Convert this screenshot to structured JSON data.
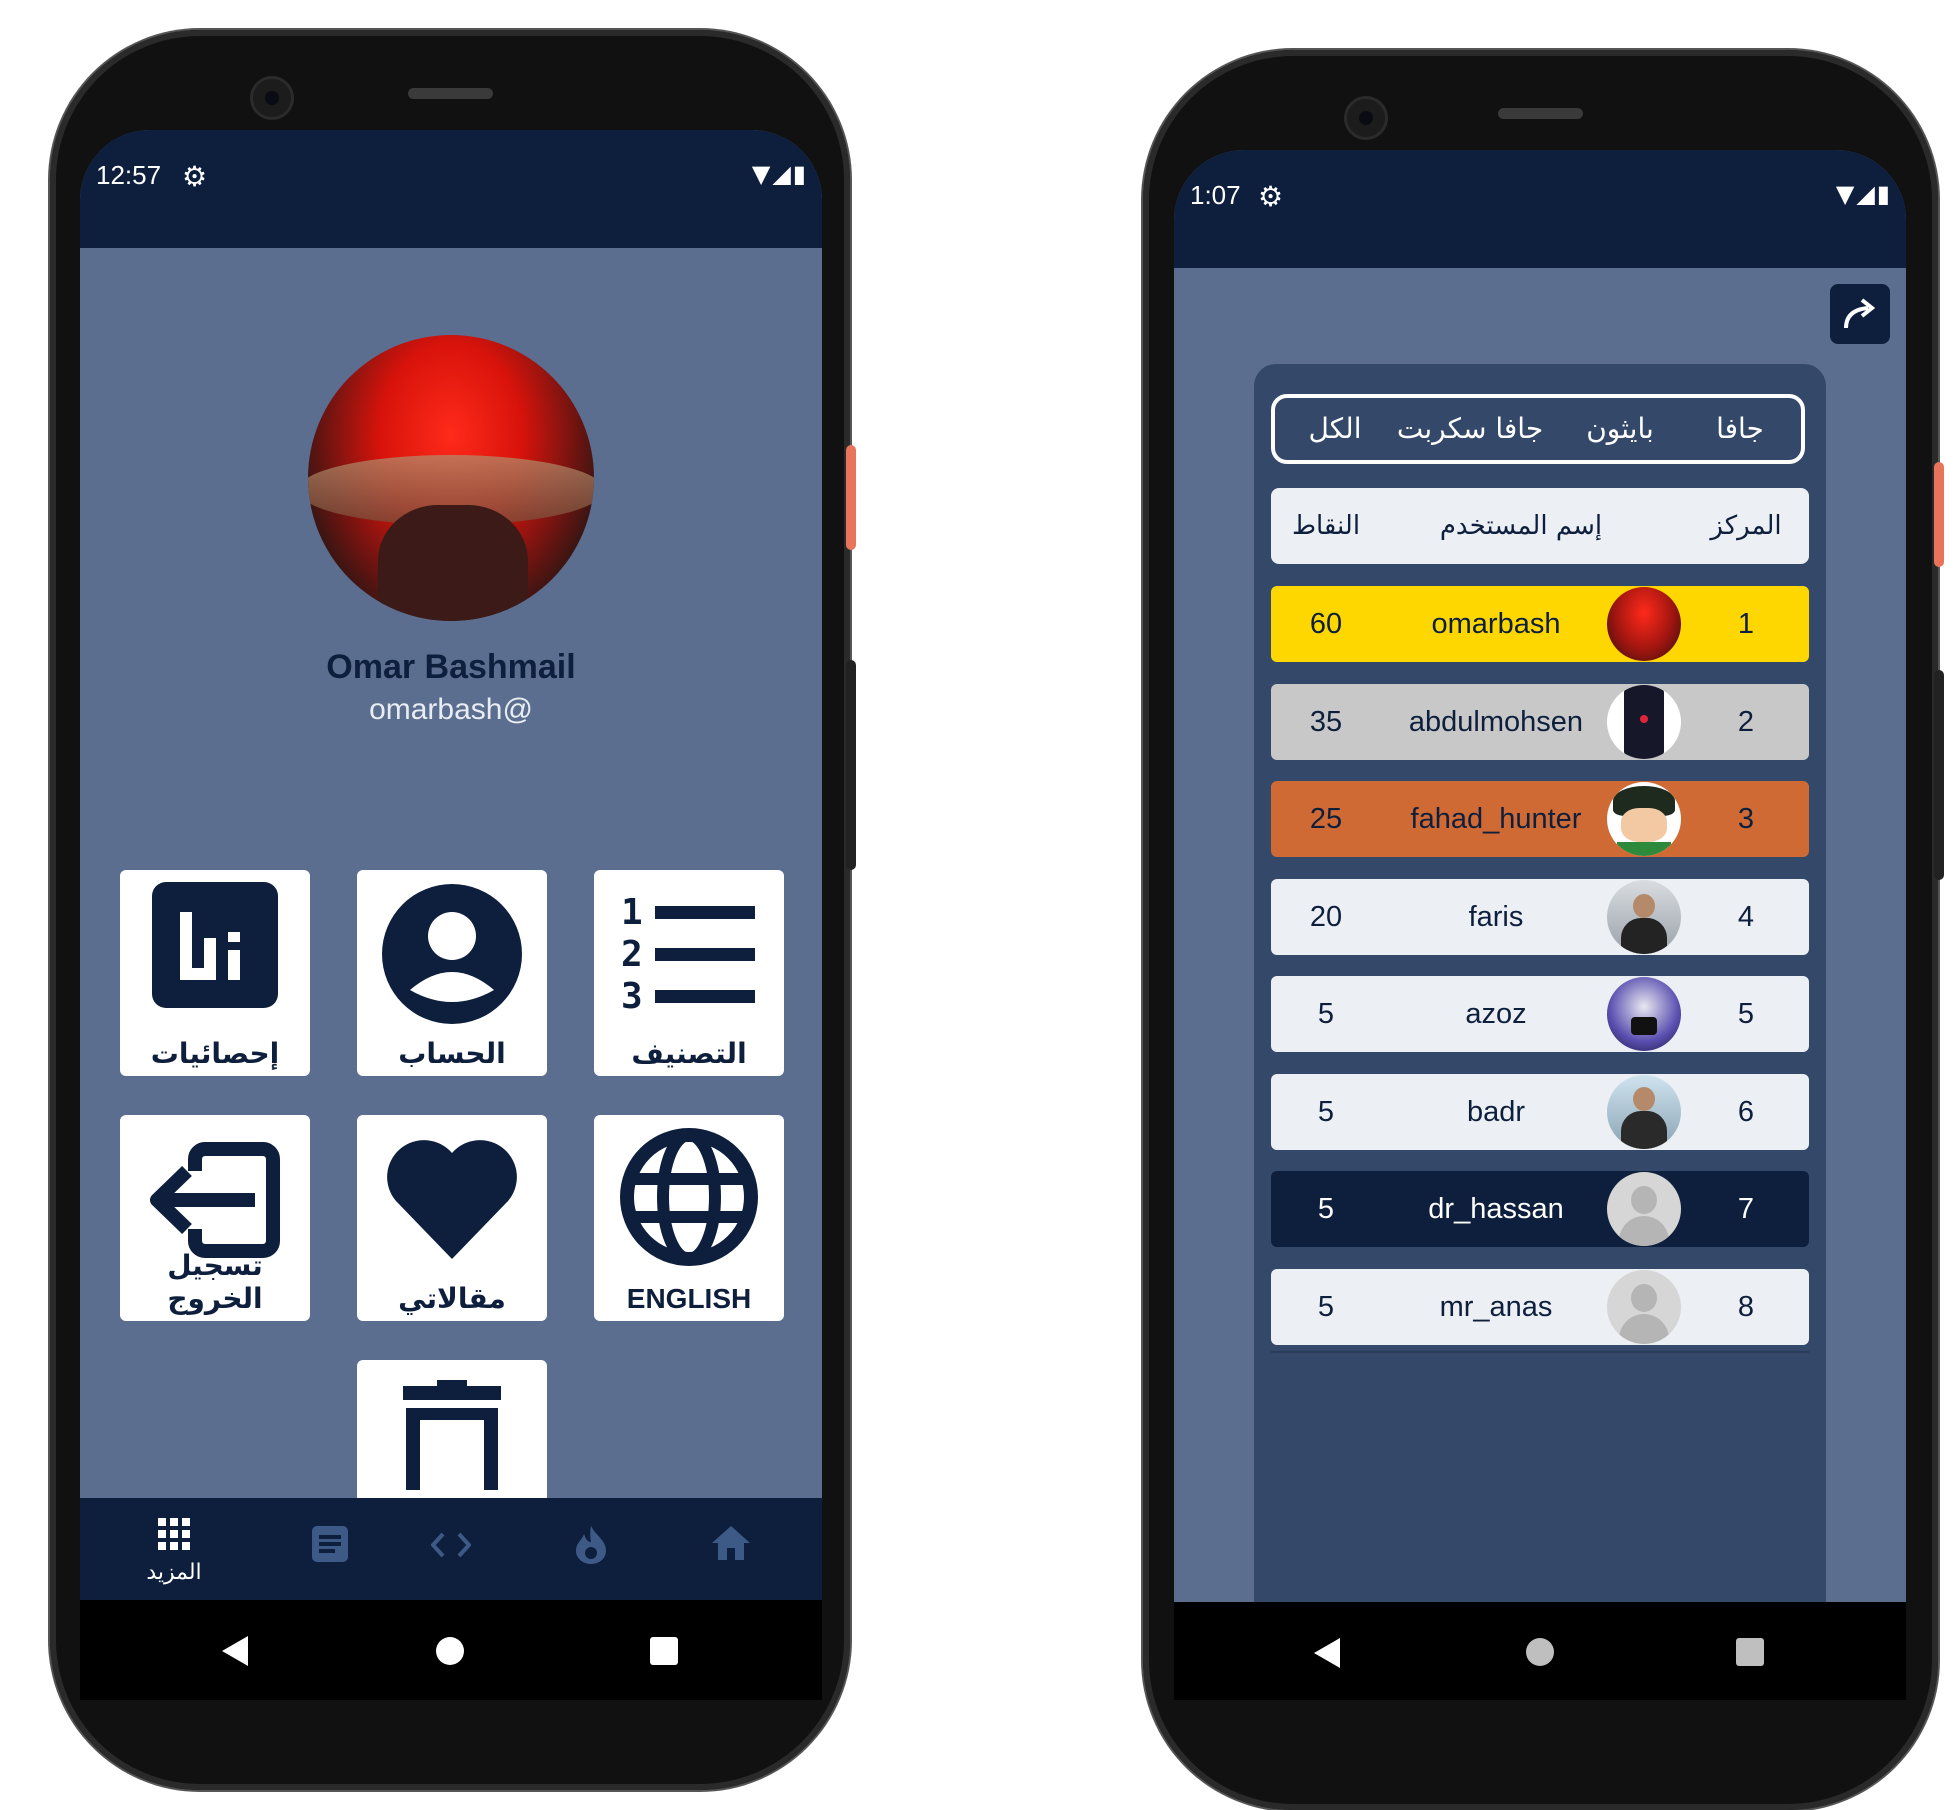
{
  "left_phone": {
    "status_bar": {
      "time": "12:57",
      "settings_icon": "gear-icon",
      "icons": [
        "wifi-icon",
        "signal-icon",
        "battery-icon"
      ]
    },
    "profile": {
      "display_name": "Omar Bashmail",
      "username": "omarbash@"
    },
    "tiles": [
      {
        "label": "إحصائيات",
        "icon": "bar-chart-icon"
      },
      {
        "label": "الحساب",
        "icon": "account-circle-icon"
      },
      {
        "label": "التصنيف",
        "icon": "numbered-list-icon"
      },
      {
        "label": "تسجيل الخروج",
        "icon": "logout-icon"
      },
      {
        "label": "مقالاتي",
        "icon": "heart-icon"
      },
      {
        "label": "ENGLISH",
        "icon": "globe-icon"
      },
      {
        "label": "",
        "icon": "trash-icon"
      }
    ],
    "bottom_nav": [
      {
        "label": "المزيد",
        "icon": "apps-grid-icon",
        "active": true
      },
      {
        "label": "",
        "icon": "article-icon",
        "active": false
      },
      {
        "label": "",
        "icon": "code-icon",
        "active": false
      },
      {
        "label": "",
        "icon": "fire-icon",
        "active": false
      },
      {
        "label": "",
        "icon": "home-icon",
        "active": false
      }
    ]
  },
  "right_phone": {
    "status_bar": {
      "time": "1:07",
      "settings_icon": "gear-icon",
      "icons": [
        "wifi-icon",
        "signal-icon",
        "battery-icon"
      ]
    },
    "share_icon": "share-arrow-icon",
    "filter_tabs": [
      "الكل",
      "جافا سكربت",
      "بايثون",
      "جافا"
    ],
    "table_headers": {
      "points": "النقاط",
      "username": "إسم المستخدم",
      "rank": "المركز"
    },
    "leaderboard": [
      {
        "points": "60",
        "username": "omarbash",
        "rank": "1",
        "color": "#ffd700"
      },
      {
        "points": "35",
        "username": "abdulmohsen",
        "rank": "2",
        "color": "#c8c8c8"
      },
      {
        "points": "25",
        "username": "fahad_hunter",
        "rank": "3",
        "color": "#d06a34"
      },
      {
        "points": "20",
        "username": "faris",
        "rank": "4",
        "color": "#eceff3"
      },
      {
        "points": "5",
        "username": "azoz",
        "rank": "5",
        "color": "#eceff3"
      },
      {
        "points": "5",
        "username": "badr",
        "rank": "6",
        "color": "#eceff3"
      },
      {
        "points": "5",
        "username": "dr_hassan",
        "rank": "7",
        "color": "#0e1f3d"
      },
      {
        "points": "5",
        "username": "mr_anas",
        "rank": "8",
        "color": "#eceff3"
      }
    ]
  },
  "colors": {
    "navy": "#0e1f3d",
    "screen_bg": "#5b6e8f",
    "panel_bg": "#34486a",
    "gold": "#ffd700",
    "silver": "#c8c8c8",
    "bronze": "#d06a34"
  }
}
